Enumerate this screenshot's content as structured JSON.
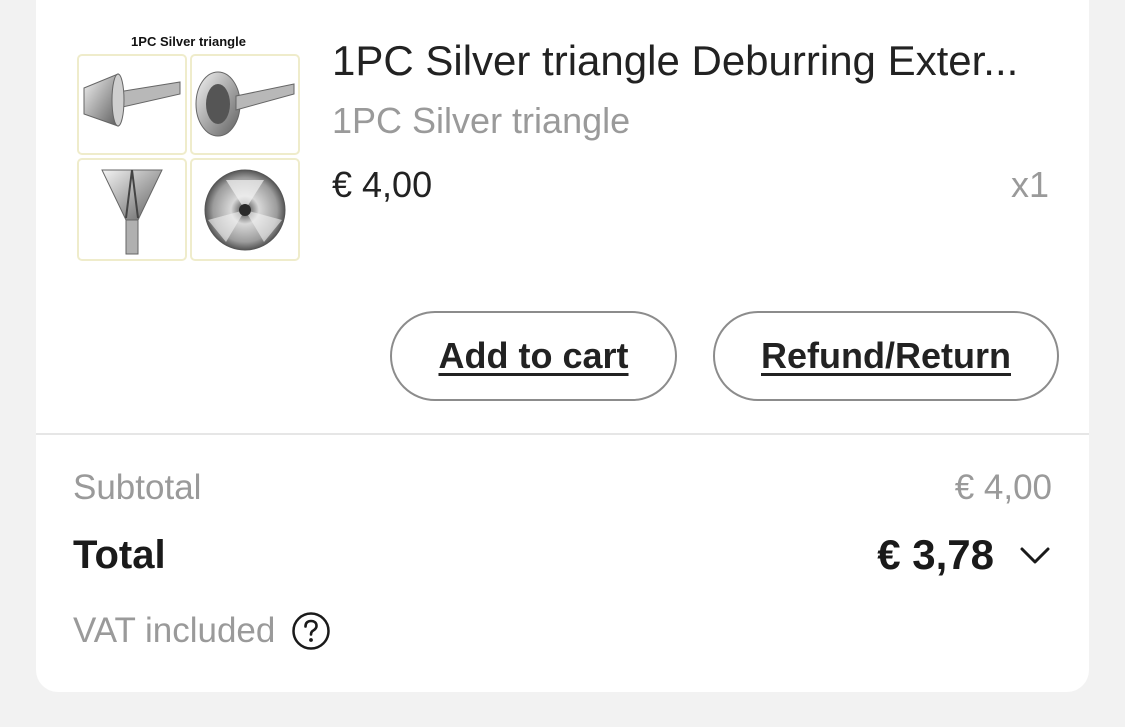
{
  "item": {
    "thumbnail_caption": "1PC Silver triangle",
    "title": "1PC Silver triangle Deburring Exter...",
    "variant": "1PC Silver triangle",
    "price": "€ 4,00",
    "quantity": "x1"
  },
  "actions": {
    "add_to_cart": "Add to cart",
    "refund_return": "Refund/Return"
  },
  "summary": {
    "subtotal_label": "Subtotal",
    "subtotal_value": "€ 4,00",
    "total_label": "Total",
    "total_value": "€ 3,78",
    "vat_label": "VAT included"
  },
  "icons": {
    "expand": "chevron-down-icon",
    "help": "question-circle-icon"
  },
  "colors": {
    "background": "#f2f2f2",
    "card": "#ffffff",
    "muted_text": "#9a9a9a",
    "primary_text": "#222222",
    "button_border": "#8c8c8c"
  }
}
